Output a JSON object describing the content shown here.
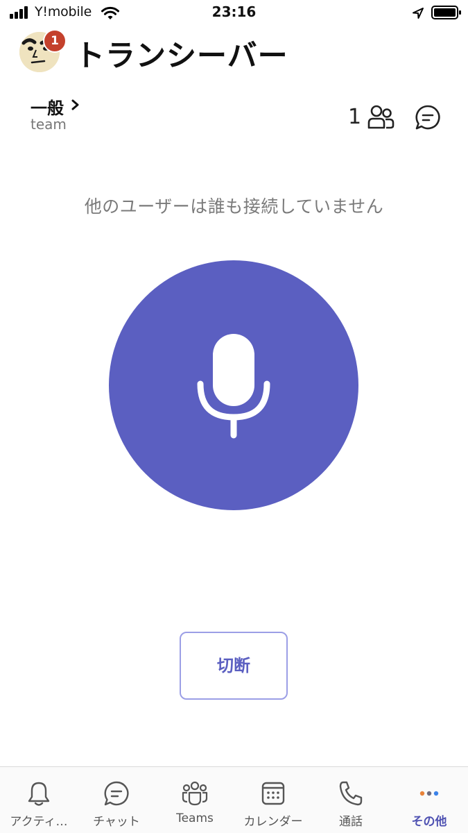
{
  "status_bar": {
    "carrier": "Y!mobile",
    "time": "23:16",
    "icons": [
      "signal-icon",
      "wifi-icon",
      "location-arrow-icon",
      "battery-icon"
    ]
  },
  "header": {
    "title": "トランシーバー",
    "notification_count": "1"
  },
  "channel": {
    "name": "一般",
    "team": "team",
    "participant_count": "1"
  },
  "main": {
    "status_message": "他のユーザーは誰も接続していません",
    "disconnect_label": "切断"
  },
  "tab_bar": {
    "items": [
      {
        "label": "アクティ…",
        "icon": "bell-icon"
      },
      {
        "label": "チャット",
        "icon": "chat-icon"
      },
      {
        "label": "Teams",
        "icon": "teams-icon"
      },
      {
        "label": "カレンダー",
        "icon": "calendar-icon"
      },
      {
        "label": "通話",
        "icon": "phone-icon"
      },
      {
        "label": "その他",
        "icon": "more-icon",
        "active": true
      }
    ]
  },
  "colors": {
    "accent": "#5b5fc1",
    "badge": "#c4412c",
    "button_border": "#9b9ee6",
    "muted_text": "#7a7a7a"
  }
}
